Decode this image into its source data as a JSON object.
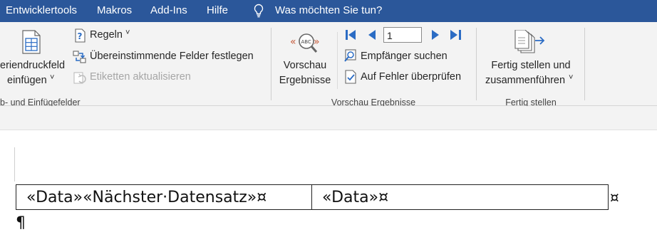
{
  "menubar": {
    "items": [
      "Entwicklertools",
      "Makros",
      "Add-Ins",
      "Hilfe"
    ],
    "tell_me": "Was möchten Sie tun?"
  },
  "ribbon": {
    "group_insert": {
      "field_button_line1": "eriendruckfeld",
      "field_button_line2": "einfügen",
      "rules_label": "Regeln",
      "match_fields_label": "Übereinstimmende Felder festlegen",
      "update_labels_label": "Etiketten aktualisieren",
      "group_label": "b- und Einfügefelder"
    },
    "group_preview": {
      "preview_line1": "Vorschau",
      "preview_line2": "Ergebnisse",
      "record_number": "1",
      "find_recipient_label": "Empfänger suchen",
      "check_errors_label": "Auf Fehler überprüfen",
      "group_label": "Vorschau Ergebnisse"
    },
    "group_finish": {
      "finish_line1": "Fertig stellen und",
      "finish_line2": "zusammenführen",
      "group_label": "Fertig stellen"
    }
  },
  "document": {
    "cell1": "«Data»«Nächster·Datensatz»¤",
    "cell2": "«Data»¤",
    "row_end_mark": "¤",
    "paragraph_mark": "¶"
  },
  "colors": {
    "title_bar": "#2b579a",
    "ribbon_bg": "#f3f3f3",
    "nav_arrow": "#2b6cc4"
  }
}
